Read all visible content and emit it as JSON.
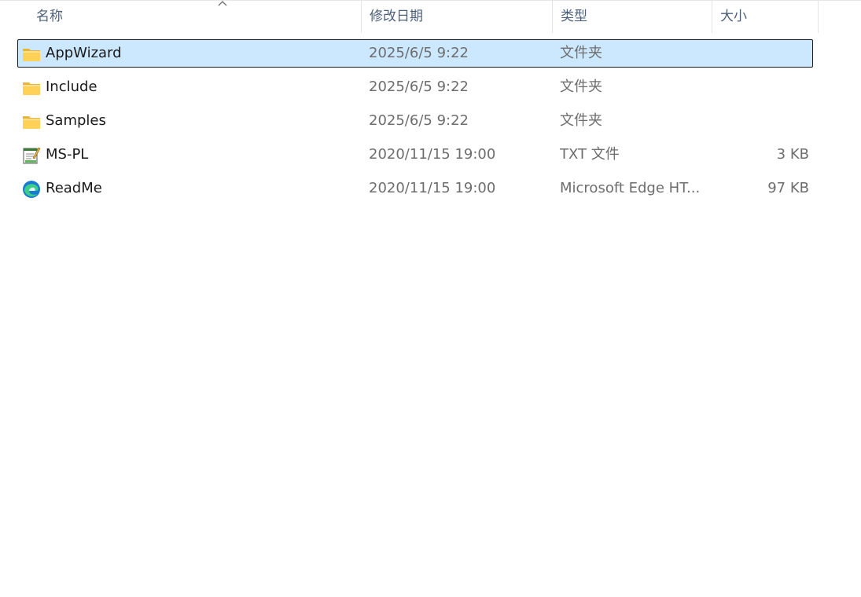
{
  "columns": {
    "name": "名称",
    "date": "修改日期",
    "type": "类型",
    "size": "大小"
  },
  "files": [
    {
      "name": "AppWizard",
      "date": "2025/6/5 9:22",
      "type": "文件夹",
      "size": "",
      "icon": "folder-icon",
      "selected": true
    },
    {
      "name": "Include",
      "date": "2025/6/5 9:22",
      "type": "文件夹",
      "size": "",
      "icon": "folder-icon",
      "selected": false
    },
    {
      "name": "Samples",
      "date": "2025/6/5 9:22",
      "type": "文件夹",
      "size": "",
      "icon": "folder-icon",
      "selected": false
    },
    {
      "name": "MS-PL",
      "date": "2020/11/15 19:00",
      "type": "TXT 文件",
      "size": "3 KB",
      "icon": "text-file-icon",
      "selected": false
    },
    {
      "name": "ReadMe",
      "date": "2020/11/15 19:00",
      "type": "Microsoft Edge HT...",
      "size": "97 KB",
      "icon": "edge-icon",
      "selected": false
    }
  ],
  "colors": {
    "selection_bg": "#cce8ff",
    "header_text": "#4c607a"
  }
}
